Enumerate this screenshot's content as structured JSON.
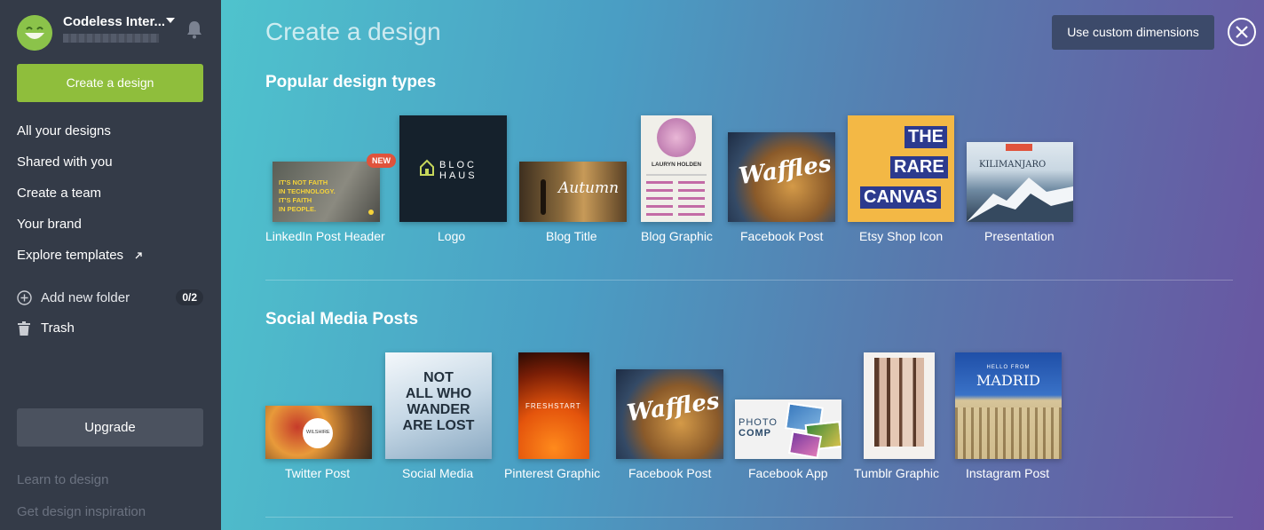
{
  "account": {
    "name": "Codeless Inter...",
    "avatar_color": "#8bc34a"
  },
  "sidebar": {
    "create_label": "Create a design",
    "nav": [
      {
        "label": "All your designs"
      },
      {
        "label": "Shared with you"
      },
      {
        "label": "Create a team"
      },
      {
        "label": "Your brand"
      },
      {
        "label": "Explore templates"
      }
    ],
    "add_folder_label": "Add new folder",
    "folder_count": "0/2",
    "trash_label": "Trash",
    "upgrade_label": "Upgrade",
    "footer_links": [
      {
        "label": "Learn to design"
      },
      {
        "label": "Get design inspiration"
      }
    ]
  },
  "main": {
    "title": "Create a design",
    "custom_dimensions_label": "Use custom dimensions",
    "sections": [
      {
        "title": "Popular design types",
        "items": [
          {
            "label": "LinkedIn Post Header",
            "badge": "NEW",
            "thumb_text": [
              "IT'S NOT FAITH",
              "IN TECHNOLOGY.",
              "IT'S FAITH",
              "IN PEOPLE."
            ]
          },
          {
            "label": "Logo",
            "thumb_text": [
              "BLOC",
              "HAUS"
            ]
          },
          {
            "label": "Blog Title",
            "thumb_text": [
              "Autumn"
            ]
          },
          {
            "label": "Blog Graphic",
            "thumb_text": [
              "LAURYN HOLDEN"
            ]
          },
          {
            "label": "Facebook Post",
            "thumb_text": [
              "Waffles"
            ]
          },
          {
            "label": "Etsy Shop Icon",
            "thumb_text": [
              "THE",
              "RARE",
              "CANVAS"
            ]
          },
          {
            "label": "Presentation",
            "thumb_text": [
              "KILIMANJARO"
            ]
          }
        ]
      },
      {
        "title": "Social Media Posts",
        "items": [
          {
            "label": "Twitter Post",
            "thumb_text": [
              "WILSHIRE"
            ]
          },
          {
            "label": "Social Media",
            "thumb_text": [
              "NOT",
              "ALL WHO",
              "WANDER",
              "ARE LOST"
            ]
          },
          {
            "label": "Pinterest Graphic",
            "thumb_text": [
              "FRESHSTART"
            ]
          },
          {
            "label": "Facebook Post",
            "thumb_text": [
              "Waffles"
            ]
          },
          {
            "label": "Facebook App",
            "thumb_text": [
              "PHOTO",
              "COMP"
            ]
          },
          {
            "label": "Tumblr Graphic",
            "thumb_text": []
          },
          {
            "label": "Instagram Post",
            "thumb_text": [
              "HELLO FROM",
              "MADRID"
            ]
          }
        ]
      }
    ]
  },
  "colors": {
    "sidebar_bg": "#343b48",
    "create_button": "#8fbe3c",
    "upgrade_button": "#4b525f",
    "new_badge": "#e0533c",
    "custom_button": "#3c4a6a"
  },
  "icons": [
    "bell-icon",
    "chevron-down-icon",
    "plus-circle-icon",
    "trash-icon",
    "external-link-icon",
    "close-icon"
  ]
}
